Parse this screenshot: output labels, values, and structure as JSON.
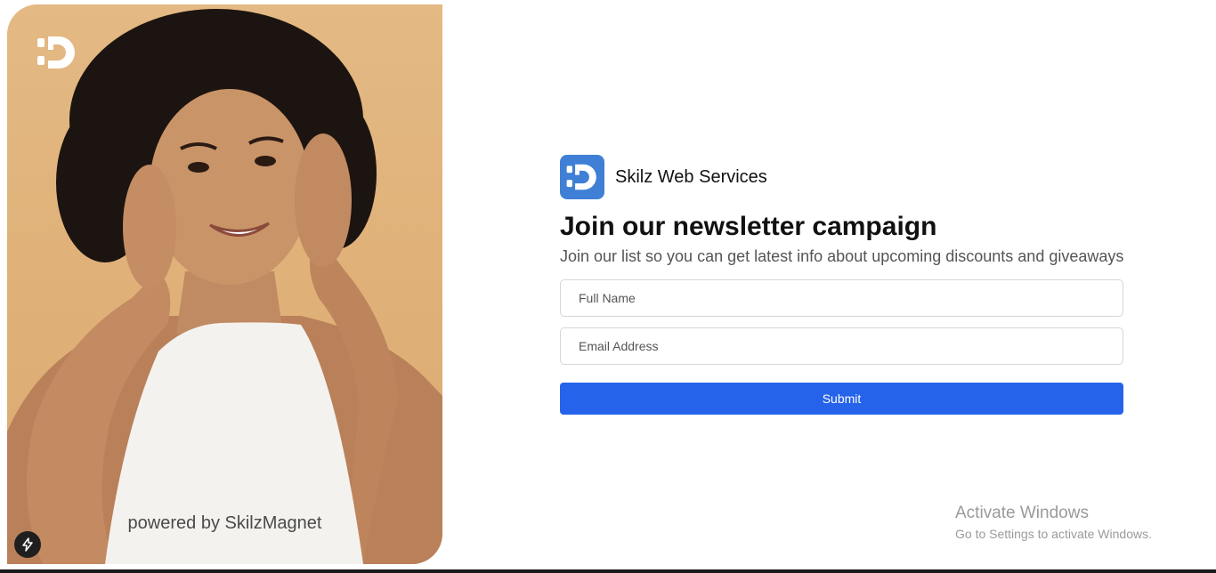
{
  "hero": {
    "powered_by": "powered by SkilzMagnet",
    "logo_icon": "skilz-logo-icon",
    "bolt_icon": "lightning-bolt-icon"
  },
  "brand": {
    "name": "Skilz Web Services",
    "icon": "skilz-logo-icon",
    "accent_color": "#3f7fd6"
  },
  "form": {
    "headline": "Join our newsletter campaign",
    "subline": "Join our list so you can get latest info about upcoming discounts and giveaways",
    "full_name_placeholder": "Full Name",
    "email_placeholder": "Email Address",
    "submit_label": "Submit",
    "submit_color": "#2563eb"
  },
  "watermark": {
    "title": "Activate Windows",
    "subtitle": "Go to Settings to activate Windows."
  }
}
